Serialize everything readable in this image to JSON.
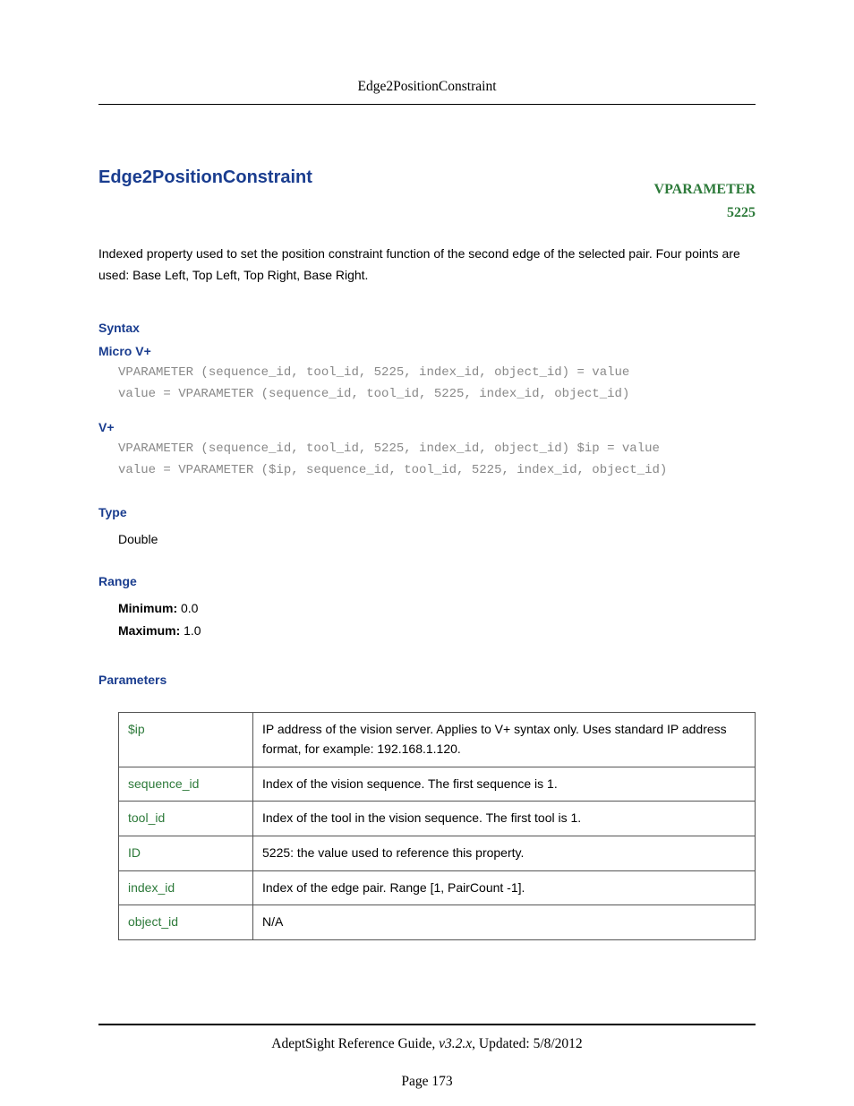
{
  "header": {
    "title": "Edge2PositionConstraint"
  },
  "title": "Edge2PositionConstraint",
  "vparameter": {
    "label": "VPARAMETER",
    "id": "5225"
  },
  "description": "Indexed property used to set the position constraint function of the second edge of the selected pair. Four points are used: Base Left, Top Left, Top Right, Base Right.",
  "syntax": {
    "heading": "Syntax",
    "microv": {
      "heading": "Micro V+",
      "line1": "VPARAMETER (sequence_id, tool_id, 5225, index_id, object_id) = value",
      "line2": "value = VPARAMETER (sequence_id, tool_id, 5225, index_id, object_id)"
    },
    "vplus": {
      "heading": "V+",
      "line1": "VPARAMETER (sequence_id, tool_id, 5225, index_id, object_id) $ip = value",
      "line2": "value = VPARAMETER ($ip, sequence_id, tool_id, 5225, index_id, object_id)"
    }
  },
  "type": {
    "heading": "Type",
    "value": "Double"
  },
  "range": {
    "heading": "Range",
    "min_label": "Minimum:",
    "min_value": " 0.0",
    "max_label": "Maximum:",
    "max_value": " 1.0"
  },
  "parameters": {
    "heading": "Parameters",
    "rows": [
      {
        "name": "$ip",
        "desc": "IP address of the vision server. Applies to V+ syntax only. Uses standard IP address format, for example: 192.168.1.120."
      },
      {
        "name": "sequence_id",
        "desc": "Index of the vision sequence. The first sequence is 1."
      },
      {
        "name": "tool_id",
        "desc": "Index of the tool in the vision sequence. The first tool is 1."
      },
      {
        "name": "ID",
        "desc": "5225: the value used to reference this property."
      },
      {
        "name": "index_id",
        "desc": "Index of the edge pair. Range [1, PairCount -1]."
      },
      {
        "name": "object_id",
        "desc": "N/A"
      }
    ]
  },
  "footer": {
    "doc": "AdeptSight Reference Guide",
    "version": ", v3.2.x",
    "updated": ", Updated: 5/8/2012",
    "page": "Page 173"
  }
}
